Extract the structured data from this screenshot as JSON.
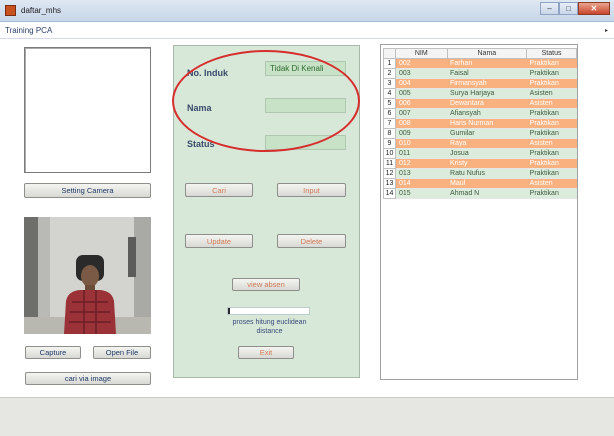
{
  "window": {
    "title": "daftar_mhs"
  },
  "menubar": {
    "label": "Training PCA",
    "arrow": "▸"
  },
  "left": {
    "setting_camera": "Setting Camera",
    "capture": "Capture",
    "open_file": "Open File",
    "cari_via_image": "cari via image"
  },
  "form": {
    "no_induk_label": "No. Induk",
    "no_induk_value": "Tidak Di Kenali",
    "nama_label": "Nama",
    "nama_value": "",
    "status_label": "Status",
    "status_value": "",
    "cari": "Cari",
    "input": "Input",
    "update": "Update",
    "delete": "Delete",
    "view_absen": "view absen",
    "progress_fraction": 0.02,
    "process_label": "proses hitung euclidean distance",
    "exit": "Exit"
  },
  "table": {
    "columns": [
      "",
      "NIM",
      "Nama",
      "Status"
    ],
    "rows": [
      {
        "idx": "1",
        "nim": "002",
        "nama": "Farhan",
        "status": "Praktikan",
        "style": "orange"
      },
      {
        "idx": "2",
        "nim": "003",
        "nama": "Faisal",
        "status": "Praktikan",
        "style": "green"
      },
      {
        "idx": "3",
        "nim": "004",
        "nama": "Firmansyah",
        "status": "Praktikan",
        "style": "orange"
      },
      {
        "idx": "4",
        "nim": "005",
        "nama": "Surya Harjaya",
        "status": "Asisten",
        "style": "green"
      },
      {
        "idx": "5",
        "nim": "006",
        "nama": "Dewantara",
        "status": "Asisten",
        "style": "orange"
      },
      {
        "idx": "6",
        "nim": "007",
        "nama": "Afiansyah",
        "status": "Praktikan",
        "style": "green"
      },
      {
        "idx": "7",
        "nim": "008",
        "nama": "Haris Nurman",
        "status": "Praktikan",
        "style": "orange"
      },
      {
        "idx": "8",
        "nim": "009",
        "nama": "Gumilar",
        "status": "Praktikan",
        "style": "green"
      },
      {
        "idx": "9",
        "nim": "010",
        "nama": "Raya",
        "status": "Asisten",
        "style": "orange"
      },
      {
        "idx": "10",
        "nim": "011",
        "nama": "Josua",
        "status": "Praktikan",
        "style": "green"
      },
      {
        "idx": "11",
        "nim": "012",
        "nama": "Kristy",
        "status": "Praktikan",
        "style": "orange"
      },
      {
        "idx": "12",
        "nim": "013",
        "nama": "Ratu Nufus",
        "status": "Praktikan",
        "style": "green"
      },
      {
        "idx": "13",
        "nim": "014",
        "nama": "Maul",
        "status": "Asisten",
        "style": "orange"
      },
      {
        "idx": "14",
        "nim": "015",
        "nama": "Ahmad N",
        "status": "Praktikan",
        "style": "green"
      }
    ]
  },
  "colors": {
    "row_orange": "#f9b27f",
    "row_green": "#dcecdc",
    "form_panel": "#d8e8d8",
    "highlight_oval": "#d62e2e"
  }
}
